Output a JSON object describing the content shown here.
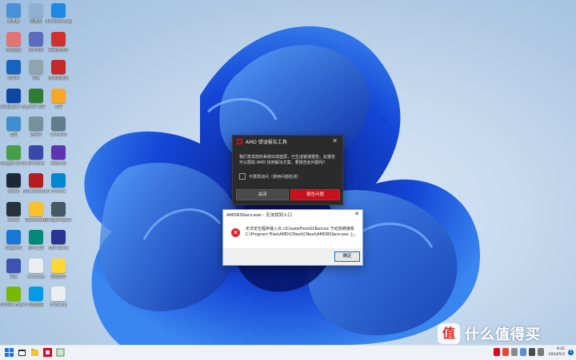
{
  "desktop": {
    "icons": [
      {
        "label": "此电脑",
        "color": "#4a90d9"
      },
      {
        "label": "回收站",
        "color": "#8fb0d0"
      },
      {
        "label": "Microsoft Edge",
        "color": "#1e88e5"
      },
      {
        "label": "控制面板",
        "color": "#e57373"
      },
      {
        "label": "PDF文件",
        "color": "#5c6bc0"
      },
      {
        "label": "网易云音乐",
        "color": "#d32f2f"
      },
      {
        "label": "文件夹",
        "color": "#1565c0"
      },
      {
        "label": "文档",
        "color": "#90a4ae"
      },
      {
        "label": "游戏加速器",
        "color": "#c62828"
      },
      {
        "label": "Wallpaper Engine",
        "color": "#0d47a1"
      },
      {
        "label": "Excel 文件",
        "color": "#2e7d32"
      },
      {
        "label": "工具",
        "color": "#f9a825"
      },
      {
        "label": "截图",
        "color": "#3e8ed0"
      },
      {
        "label": "记事本",
        "color": "#78909c"
      },
      {
        "label": "CAMERA",
        "color": "#607d8b"
      },
      {
        "label": "Google Chrome",
        "color": "#43a047"
      },
      {
        "label": "Windows",
        "color": "#3949ab"
      },
      {
        "label": "系统工具",
        "color": "#5e35b1"
      },
      {
        "label": "Steam",
        "color": "#1b2838"
      },
      {
        "label": "MSI Afterburner",
        "color": "#b71c1c"
      },
      {
        "label": "Chrome",
        "color": "#0288d1"
      },
      {
        "label": "steam",
        "color": "#263238"
      },
      {
        "label": "Downloads",
        "color": "#fbc02d"
      },
      {
        "label": "ImageMagick",
        "color": "#455a64"
      },
      {
        "label": "Wegame",
        "color": "#1976d2"
      },
      {
        "label": "显卡工具",
        "color": "#00897b"
      },
      {
        "label": "HEX Editor",
        "color": "#283593"
      },
      {
        "label": "设置",
        "color": "#3f51b5"
      },
      {
        "label": "drvSetup",
        "color": "#eceff1"
      },
      {
        "label": "驱动文件",
        "color": "#fdd835"
      },
      {
        "label": "NVIDIA Experience",
        "color": "#76b900"
      },
      {
        "label": "性能监控",
        "color": "#039be5"
      },
      {
        "label": "drvSetup",
        "color": "#eceff1"
      }
    ]
  },
  "amd_dialog": {
    "title": "AMD 错误报告工具",
    "close": "✕",
    "message": "我们发现您的系统出现蓝屏，已生成错误报告。此报告可以帮助 AMD 找到解决方案。要报告此问题吗？",
    "checkbox_label": "不要再询问（禁用问题检测）",
    "close_button": "关闭",
    "report_button": "报告问题"
  },
  "error_dialog": {
    "title": "AMDRSServ.exe - 无法找到入口",
    "close": "✕",
    "icon": "✕",
    "message": "无法定位程序输入点 clCreateFromGLTexture 于动态链接库 C:\\Program Files\\AMD\\CNext\\CNext\\AMDRSServ.exe 上。",
    "ok_button": "确定"
  },
  "taskbar": {
    "time": "9:42",
    "date": "2024/5/3",
    "notification_count": "1",
    "icons": [
      "start-icon",
      "search-icon",
      "file-explorer-icon",
      "amd-app-icon",
      "task-icon"
    ]
  },
  "watermark": {
    "badge": "值",
    "text": "什么值得买"
  },
  "colors": {
    "amd_red": "#c8101e",
    "accent_blue": "#0078d4",
    "dialog_dark": "#2b2b2b"
  }
}
